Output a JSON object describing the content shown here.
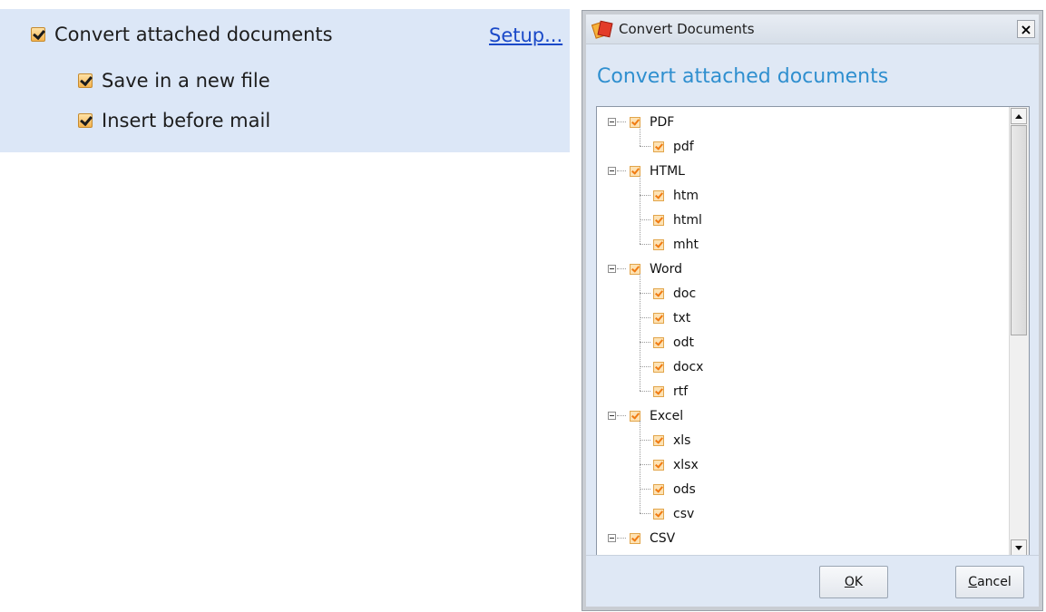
{
  "options_panel": {
    "convert_label": "Convert attached documents",
    "convert_checked": true,
    "setup_link": "Setup...",
    "save_new_file_label": "Save in a new file",
    "save_new_file_checked": true,
    "insert_before_mail_label": "Insert before mail",
    "insert_before_mail_checked": true
  },
  "dialog": {
    "title": "Convert Documents",
    "close_glyph": "×",
    "heading": "Convert attached documents",
    "tree": [
      {
        "label": "PDF",
        "checked": true,
        "children": [
          {
            "label": "pdf",
            "checked": true
          }
        ]
      },
      {
        "label": "HTML",
        "checked": true,
        "children": [
          {
            "label": "htm",
            "checked": true
          },
          {
            "label": "html",
            "checked": true
          },
          {
            "label": "mht",
            "checked": true
          }
        ]
      },
      {
        "label": "Word",
        "checked": true,
        "children": [
          {
            "label": "doc",
            "checked": true
          },
          {
            "label": "txt",
            "checked": true
          },
          {
            "label": "odt",
            "checked": true
          },
          {
            "label": "docx",
            "checked": true
          },
          {
            "label": "rtf",
            "checked": true
          }
        ]
      },
      {
        "label": "Excel",
        "checked": true,
        "children": [
          {
            "label": "xls",
            "checked": true
          },
          {
            "label": "xlsx",
            "checked": true
          },
          {
            "label": "ods",
            "checked": true
          },
          {
            "label": "csv",
            "checked": true
          }
        ]
      },
      {
        "label": "CSV",
        "checked": true,
        "children": []
      }
    ],
    "ok_mnemonic": "O",
    "ok_rest": "K",
    "cancel_mnemonic": "C",
    "cancel_rest": "ancel"
  },
  "colors": {
    "panel_bg": "#dce7f7",
    "heading": "#2f8fcf",
    "link": "#1a49c8",
    "checkbox_fill": "#f4b24d"
  }
}
